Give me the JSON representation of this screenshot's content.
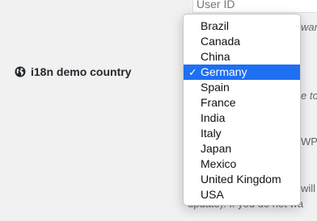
{
  "form": {
    "user_id_placeholder": "User ID",
    "row_label": "i18n demo country",
    "fragments": [
      "wan",
      "e to",
      "WP",
      "will",
      "update). If you do not wa"
    ]
  },
  "dropdown": {
    "options": [
      {
        "label": "Brazil",
        "selected": false
      },
      {
        "label": "Canada",
        "selected": false
      },
      {
        "label": "China",
        "selected": false
      },
      {
        "label": "Germany",
        "selected": true
      },
      {
        "label": "Spain",
        "selected": false
      },
      {
        "label": "France",
        "selected": false
      },
      {
        "label": "India",
        "selected": false
      },
      {
        "label": "Italy",
        "selected": false
      },
      {
        "label": "Japan",
        "selected": false
      },
      {
        "label": "Mexico",
        "selected": false
      },
      {
        "label": "United Kingdom",
        "selected": false
      },
      {
        "label": "USA",
        "selected": false
      }
    ],
    "check_symbol": "✓"
  },
  "colors": {
    "selected_bg": "#1e6ff2",
    "page_bg": "#f1f1f1"
  },
  "icons": {
    "row_icon": "globe-icon",
    "selected_icon": "checkmark-icon"
  }
}
